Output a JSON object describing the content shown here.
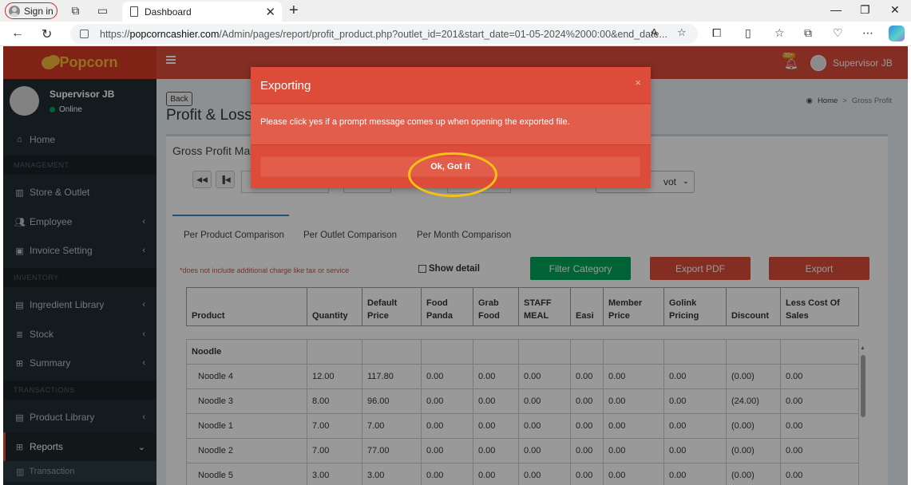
{
  "browser": {
    "signin_label": "Sign in",
    "tab_title": "Dashboard",
    "url_scheme": "https://",
    "url_host": "popcorncashier.com",
    "url_path": "/Admin/pages/report/profit_product.php?outlet_id=201&start_date=01-05-2024%2000:00&end_date..."
  },
  "app": {
    "brand": "Popcorn",
    "notif_count": "30+",
    "user_name": "Supervisor JB",
    "colors": {
      "header": "#dd4b39",
      "sidebar": "#222d32",
      "accent": "#3c8dbc"
    }
  },
  "sidebar": {
    "user_name": "Supervisor JB",
    "status": "Online",
    "home": "Home",
    "header_management": "MANAGEMENT",
    "store_outlet": "Store & Outlet",
    "employee": "Employee",
    "invoice_setting": "Invoice Setting",
    "header_inventory": "INVENTORY",
    "ingredient_library": "Ingredient Library",
    "stock": "Stock",
    "summary": "Summary",
    "header_transactions": "TRANSACTIONS",
    "product_library": "Product Library",
    "reports": "Reports",
    "transaction": "Transaction"
  },
  "content": {
    "back_label": "Back",
    "page_title": "Profit & Loss",
    "breadcrumb_home": "Home",
    "breadcrumb_current": "Gross Profit",
    "box_title": "Gross Profit Mar",
    "select_value": "vot",
    "tabs": [
      "Per Product Comparison",
      "Per Outlet Comparison",
      "Per Month Comparison"
    ],
    "note": "*does not include additional charge like tax or service",
    "show_detail": "Show detail",
    "filter_btn": "Filter Category",
    "export_pdf_btn": "Export PDF",
    "export_btn": "Export"
  },
  "table": {
    "headers": [
      "Product",
      "Quantity",
      "Default Price",
      "Food Panda",
      "Grab Food",
      "STAFF MEAL",
      "Easi",
      "Member Price",
      "Golink Pricing",
      "Discount",
      "Less Cost Of Sales"
    ],
    "group": "Noodle",
    "rows": [
      [
        "Noodle 4",
        "12.00",
        "117.80",
        "0.00",
        "0.00",
        "0.00",
        "0.00",
        "0.00",
        "0.00",
        "(0.00)",
        "0.00"
      ],
      [
        "Noodle 3",
        "8.00",
        "96.00",
        "0.00",
        "0.00",
        "0.00",
        "0.00",
        "0.00",
        "0.00",
        "(24.00)",
        "0.00"
      ],
      [
        "Noodle 1",
        "7.00",
        "7.00",
        "0.00",
        "0.00",
        "0.00",
        "0.00",
        "0.00",
        "0.00",
        "(0.00)",
        "0.00"
      ],
      [
        "Noodle 2",
        "7.00",
        "77.00",
        "0.00",
        "0.00",
        "0.00",
        "0.00",
        "0.00",
        "0.00",
        "(0.00)",
        "0.00"
      ],
      [
        "Noodle 5",
        "3.00",
        "3.00",
        "0.00",
        "0.00",
        "0.00",
        "0.00",
        "0.00",
        "0.00",
        "(0.00)",
        "0.00"
      ]
    ]
  },
  "modal": {
    "title": "Exporting",
    "close": "×",
    "message": "Please click yes if a prompt message comes up when opening the exported file.",
    "button": "Ok, Got it"
  }
}
